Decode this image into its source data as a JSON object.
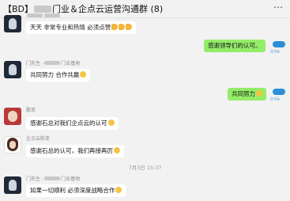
{
  "header": {
    "title_prefix": "【BD】",
    "title_middle": "门业＆企点云运营沟通群",
    "title_count": "(8)",
    "more_icon": "⋯"
  },
  "brand": {
    "name": "企点云"
  },
  "messages": [
    {
      "sender": "",
      "text": "天天 非常专业和热情 必须点赞"
    },
    {
      "text": "感谢领导们的认可。"
    },
    {
      "sender_prefix": "门先生 -",
      "sender_suffix": "门业基地",
      "text": "共同努力 合作共赢"
    },
    {
      "text": "共同努力"
    },
    {
      "sender": "鹏菲",
      "text": "感谢石总对我们企点云的认可"
    },
    {
      "sender": "企点云陈菲",
      "text": "感谢石总的认可，我们再接再厉"
    },
    {
      "sender_prefix": "门先生 -",
      "sender_suffix": "门业基地",
      "text": "如果一切顺利 必须深度战略合作"
    }
  ],
  "timestamp": "7月3日 15:37"
}
